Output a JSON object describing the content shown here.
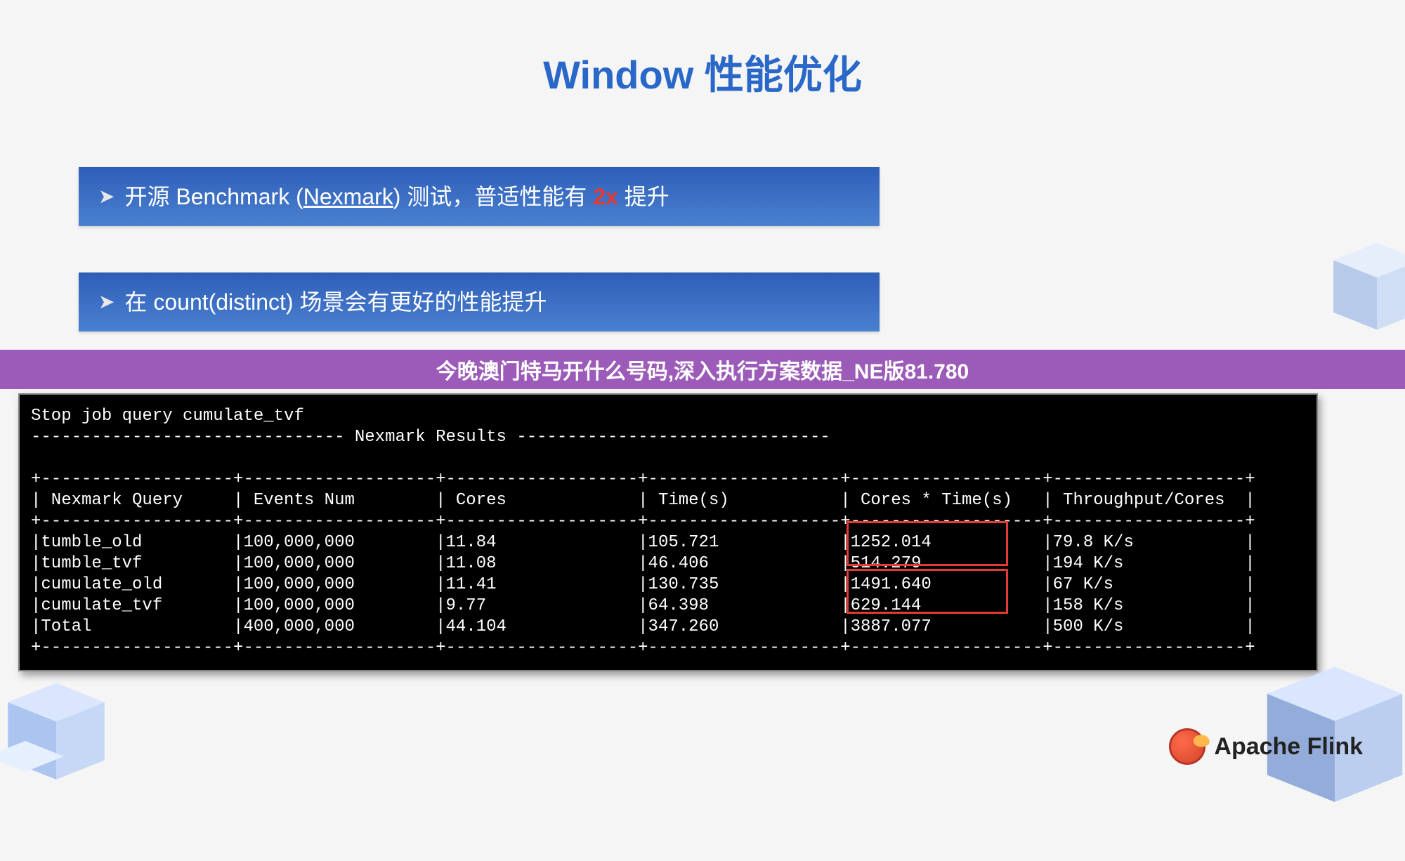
{
  "title": "Window 性能优化",
  "bullets": {
    "b1_prefix": "开源 Benchmark (",
    "b1_link": "Nexmark",
    "b1_mid": ") 测试，普适性能有 ",
    "b1_highlight": "2x",
    "b1_suffix": " 提升",
    "b2": "在 count(distinct) 场景会有更好的性能提升"
  },
  "purple_banner": "今晚澳门特马开什么号码,深入执行方案数据_NE版81.780",
  "terminal": {
    "line_stop": "Stop job query cumulate_tvf",
    "line_header_sep": "------------------------------- Nexmark Results -------------------------------",
    "table_top": "+-------------------+-------------------+-------------------+-------------------+-------------------+-------------------+",
    "table_head": "| Nexmark Query     | Events Num        | Cores             | Time(s)           | Cores * Time(s)   | Throughput/Cores  |",
    "table_sep": "+-------------------+-------------------+-------------------+-------------------+-------------------+-------------------+",
    "rows": [
      "|tumble_old         |100,000,000        |11.84              |105.721            |1252.014           |79.8 K/s           |",
      "|tumble_tvf         |100,000,000        |11.08              |46.406             |514.279            |194 K/s            |",
      "|cumulate_old       |100,000,000        |11.41              |130.735            |1491.640           |67 K/s             |",
      "|cumulate_tvf       |100,000,000        |9.77               |64.398             |629.144            |158 K/s            |",
      "|Total              |400,000,000        |44.104             |347.260            |3887.077           |500 K/s            |"
    ],
    "table_bot": "+-------------------+-------------------+-------------------+-------------------+-------------------+-------------------+"
  },
  "chart_data": {
    "type": "table",
    "title": "Nexmark Results",
    "columns": [
      "Nexmark Query",
      "Events Num",
      "Cores",
      "Time(s)",
      "Cores * Time(s)",
      "Throughput/Cores"
    ],
    "rows": [
      {
        "query": "tumble_old",
        "events": 100000000,
        "cores": 11.84,
        "time_s": 105.721,
        "cores_time": 1252.014,
        "throughput": "79.8 K/s"
      },
      {
        "query": "tumble_tvf",
        "events": 100000000,
        "cores": 11.08,
        "time_s": 46.406,
        "cores_time": 514.279,
        "throughput": "194 K/s"
      },
      {
        "query": "cumulate_old",
        "events": 100000000,
        "cores": 11.41,
        "time_s": 130.735,
        "cores_time": 1491.64,
        "throughput": "67 K/s"
      },
      {
        "query": "cumulate_tvf",
        "events": 100000000,
        "cores": 9.77,
        "time_s": 64.398,
        "cores_time": 629.144,
        "throughput": "158 K/s"
      },
      {
        "query": "Total",
        "events": 400000000,
        "cores": 44.104,
        "time_s": 347.26,
        "cores_time": 3887.077,
        "throughput": "500 K/s"
      }
    ],
    "highlights": [
      {
        "rows": [
          "tumble_old",
          "tumble_tvf"
        ],
        "column": "Cores * Time(s)"
      },
      {
        "rows": [
          "cumulate_old",
          "cumulate_tvf"
        ],
        "column": "Cores * Time(s)"
      }
    ]
  },
  "footer": {
    "brand": "Apache Flink"
  }
}
